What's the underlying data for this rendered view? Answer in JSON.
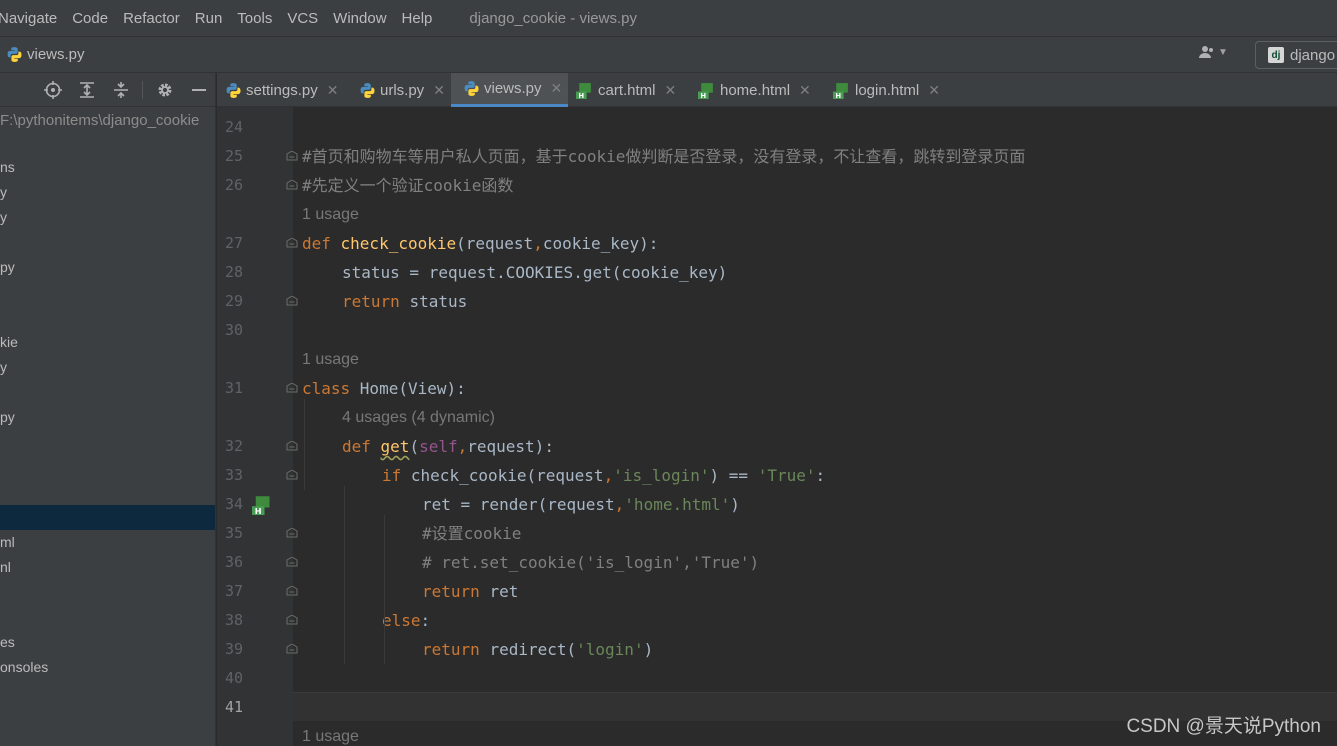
{
  "menu": [
    "Navigate",
    "Code",
    "Refactor",
    "Run",
    "Tools",
    "VCS",
    "Window",
    "Help"
  ],
  "window_title": "django_cookie - views.py",
  "navbar": {
    "file": "views.py",
    "run_config": "django"
  },
  "project": {
    "path": "F:\\pythonitems\\django_cookie",
    "rows": [
      {
        "label": "ns",
        "selected": false
      },
      {
        "label": "y",
        "selected": false
      },
      {
        "label": "y",
        "selected": false
      },
      {
        "label": "",
        "selected": false
      },
      {
        "label": "py",
        "selected": false
      },
      {
        "label": "",
        "selected": false
      },
      {
        "label": "",
        "selected": false
      },
      {
        "label": "kie",
        "selected": false
      },
      {
        "label": "y",
        "selected": false
      },
      {
        "label": "",
        "selected": false
      },
      {
        "label": "py",
        "selected": false
      },
      {
        "label": "",
        "selected": false
      },
      {
        "label": "",
        "selected": false
      },
      {
        "label": "",
        "selected": false
      },
      {
        "label": "",
        "selected": true
      },
      {
        "label": "ml",
        "selected": false
      },
      {
        "label": "nl",
        "selected": false
      },
      {
        "label": "",
        "selected": false
      },
      {
        "label": "",
        "selected": false
      },
      {
        "label": "es",
        "selected": false
      },
      {
        "label": "onsoles",
        "selected": false
      }
    ]
  },
  "tabs": [
    {
      "label": "settings.py",
      "type": "py",
      "active": false
    },
    {
      "label": "urls.py",
      "type": "py",
      "active": false
    },
    {
      "label": "views.py",
      "type": "py",
      "active": true
    },
    {
      "label": "cart.html",
      "type": "html",
      "active": false
    },
    {
      "label": "home.html",
      "type": "html",
      "active": false
    },
    {
      "label": "login.html",
      "type": "html",
      "active": false
    }
  ],
  "editor": {
    "current_line": "41",
    "lines": [
      {
        "kind": "code",
        "num": "24",
        "indent": 0,
        "tokens": []
      },
      {
        "kind": "code",
        "num": "25",
        "indent": 0,
        "fold": true,
        "tokens": [
          [
            "cmt",
            "#首页和购物车等用户私人页面，基于cookie做判断是否登录，没有登录，不让查看，跳转到登录页面"
          ]
        ]
      },
      {
        "kind": "code",
        "num": "26",
        "indent": 0,
        "fold": true,
        "tokens": [
          [
            "cmt",
            "#先定义一个验证cookie函数"
          ]
        ]
      },
      {
        "kind": "inlay",
        "indent": 0,
        "text": "1 usage"
      },
      {
        "kind": "code",
        "num": "27",
        "indent": 0,
        "fold": true,
        "tokens": [
          [
            "kw",
            "def "
          ],
          [
            "fn",
            "check_cookie"
          ],
          [
            "",
            "(request"
          ],
          [
            "kw",
            ","
          ],
          [
            "",
            "cookie_key):"
          ]
        ]
      },
      {
        "kind": "code",
        "num": "28",
        "indent": 1,
        "tokens": [
          [
            "",
            "status = request.COOKIES.get(cookie_key)"
          ]
        ]
      },
      {
        "kind": "code",
        "num": "29",
        "indent": 1,
        "fold": true,
        "tokens": [
          [
            "kw",
            "return "
          ],
          [
            "",
            "status"
          ]
        ]
      },
      {
        "kind": "code",
        "num": "30",
        "indent": 0,
        "tokens": []
      },
      {
        "kind": "inlay",
        "indent": 0,
        "text": "1 usage"
      },
      {
        "kind": "code",
        "num": "31",
        "indent": 0,
        "fold": true,
        "tokens": [
          [
            "kw",
            "class "
          ],
          [
            "",
            "Home(View):"
          ]
        ]
      },
      {
        "kind": "inlay",
        "indent": 1,
        "text": "4 usages (4 dynamic)"
      },
      {
        "kind": "code",
        "num": "32",
        "indent": 1,
        "fold": true,
        "tokens": [
          [
            "kw",
            "def "
          ],
          [
            "fn squig",
            "get"
          ],
          [
            "",
            "("
          ],
          [
            "self",
            "self"
          ],
          [
            "kw",
            ","
          ],
          [
            "",
            "request):"
          ]
        ]
      },
      {
        "kind": "code",
        "num": "33",
        "indent": 2,
        "fold": true,
        "tokens": [
          [
            "kw",
            "if "
          ],
          [
            "",
            "check_cookie(request"
          ],
          [
            "kw",
            ","
          ],
          [
            "str",
            "'is_login'"
          ],
          [
            "",
            ") == "
          ],
          [
            "str",
            "'True'"
          ],
          [
            "",
            ":"
          ]
        ]
      },
      {
        "kind": "code",
        "num": "34",
        "indent": 3,
        "marker": "html",
        "tokens": [
          [
            "",
            "ret = render(request"
          ],
          [
            "kw",
            ","
          ],
          [
            "str",
            "'home.html'"
          ],
          [
            "",
            ")"
          ]
        ]
      },
      {
        "kind": "code",
        "num": "35",
        "indent": 3,
        "fold": true,
        "tokens": [
          [
            "cmt",
            "#设置cookie"
          ]
        ]
      },
      {
        "kind": "code",
        "num": "36",
        "indent": 3,
        "fold": true,
        "tokens": [
          [
            "cmt",
            "# ret.set_cookie('is_login','True')"
          ]
        ]
      },
      {
        "kind": "code",
        "num": "37",
        "indent": 3,
        "fold": true,
        "tokens": [
          [
            "kw",
            "return "
          ],
          [
            "",
            "ret"
          ]
        ]
      },
      {
        "kind": "code",
        "num": "38",
        "indent": 2,
        "fold": true,
        "tokens": [
          [
            "kw",
            "else"
          ],
          [
            "",
            ":"
          ]
        ]
      },
      {
        "kind": "code",
        "num": "39",
        "indent": 3,
        "fold": true,
        "tokens": [
          [
            "kw",
            "return "
          ],
          [
            "",
            "redirect("
          ],
          [
            "str",
            "'login'"
          ],
          [
            "",
            ")"
          ]
        ]
      },
      {
        "kind": "code",
        "num": "40",
        "indent": 0,
        "tokens": []
      },
      {
        "kind": "code",
        "num": "41",
        "indent": 0,
        "tokens": []
      },
      {
        "kind": "inlay",
        "indent": 0,
        "text": "1 usage"
      }
    ]
  },
  "watermark": "CSDN @景天说Python",
  "colors": {
    "keyword": "#cc7832",
    "function": "#ffc66d",
    "string": "#6a8759",
    "comment": "#808080",
    "self": "#94558d",
    "selection": "#0d293e",
    "tab_underline": "#4a88c7"
  }
}
